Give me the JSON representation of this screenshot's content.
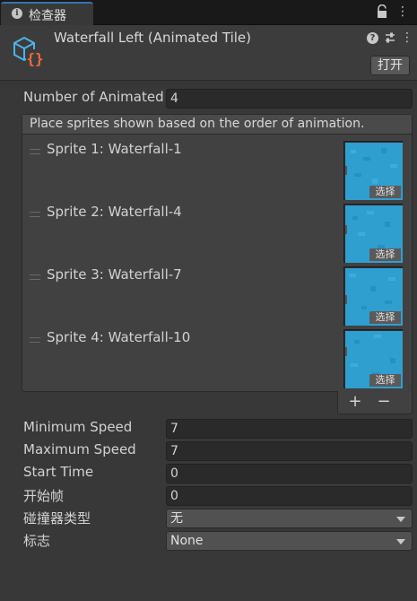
{
  "tab": {
    "label": "检查器",
    "info_icon": "info-icon"
  },
  "header": {
    "title": "Waterfall Left (Animated Tile)",
    "open_button": "打开",
    "help_glyph": "?",
    "asset_icon": "scriptable-object-icon"
  },
  "properties": {
    "number_of_animated": {
      "label": "Number of Animated",
      "value": "4"
    }
  },
  "sprite_list": {
    "header": "Place sprites shown based on the order of animation.",
    "items": [
      {
        "label": "Sprite 1: Waterfall-1",
        "select": "选择"
      },
      {
        "label": "Sprite 2: Waterfall-4",
        "select": "选择"
      },
      {
        "label": "Sprite 3: Waterfall-7",
        "select": "选择"
      },
      {
        "label": "Sprite 4: Waterfall-10",
        "select": "选择"
      }
    ],
    "add": "+",
    "remove": "−"
  },
  "settings": {
    "min_speed": {
      "label": "Minimum Speed",
      "value": "7"
    },
    "max_speed": {
      "label": "Maximum Speed",
      "value": "7"
    },
    "start_time": {
      "label": "Start Time",
      "value": "0"
    },
    "start_frame": {
      "label": "开始帧",
      "value": "0"
    },
    "collider_type": {
      "label": "碰撞器类型",
      "value": "无"
    },
    "flags": {
      "label": "标志",
      "value": "None"
    }
  },
  "colors": {
    "accent": "#3a72b0",
    "water": "#2f9fd0",
    "icon_orange": "#f26b3a",
    "icon_blue": "#4fb3e8"
  }
}
